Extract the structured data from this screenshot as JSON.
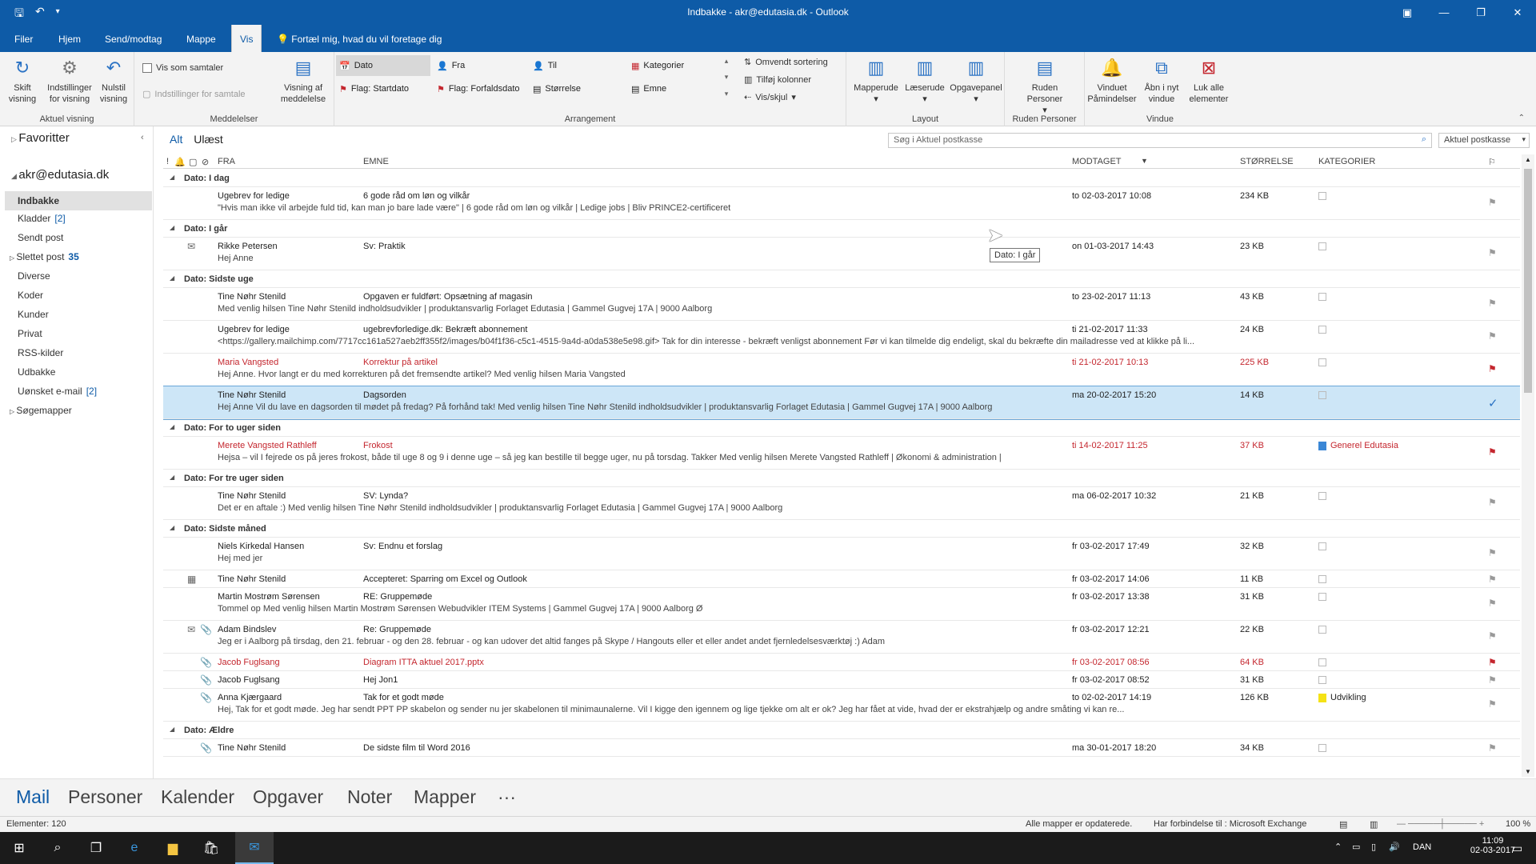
{
  "window": {
    "title": "Indbakke - akr@edutasia.dk - Outlook"
  },
  "tabs": [
    "Filer",
    "Hjem",
    "Send/modtag",
    "Mappe",
    "Vis"
  ],
  "tell_me": "Fortæl mig, hvad du vil foretage dig",
  "ribbon": {
    "current_view": {
      "label": "Aktuel visning",
      "change_view": "Skift visning",
      "view_settings": "Indstillinger for visning",
      "reset_view": "Nulstil visning"
    },
    "messages": {
      "label": "Meddelelser",
      "show_as_conversations": "Vis som samtaler",
      "conversation_settings": "Indstillinger for samtale",
      "message_preview": "Visning af meddelelse"
    },
    "arrangement": {
      "label": "Arrangement",
      "items": [
        "Dato",
        "Fra",
        "Til",
        "Kategorier",
        "Flag: Startdato",
        "Flag: Forfaldsdato",
        "Størrelse",
        "Emne"
      ],
      "reverse_sort": "Omvendt sortering",
      "add_columns": "Tilføj kolonner",
      "expand_collapse": "Vis/skjul"
    },
    "layout": {
      "label": "Layout",
      "folder_pane": "Mapperude",
      "reading_pane": "Læserude",
      "todo_bar": "Opgavepanel"
    },
    "people_pane": {
      "label": "Ruden Personer",
      "people_pane": "Ruden Personer"
    },
    "window": {
      "label": "Vindue",
      "reminders": "Vinduet Påmindelser",
      "open_new": "Åbn i nyt vindue",
      "close_all": "Luk alle elementer"
    }
  },
  "nav": {
    "favorites": "Favoritter",
    "account": "akr@edutasia.dk",
    "folders": [
      {
        "name": "Indbakke",
        "count": ""
      },
      {
        "name": "Kladder",
        "count": "[2]"
      },
      {
        "name": "Sendt post",
        "count": ""
      },
      {
        "name": "Slettet post",
        "count": "35"
      },
      {
        "name": "Diverse",
        "count": ""
      },
      {
        "name": "Koder",
        "count": ""
      },
      {
        "name": "Kunder",
        "count": ""
      },
      {
        "name": "Privat",
        "count": ""
      },
      {
        "name": "RSS-kilder",
        "count": ""
      },
      {
        "name": "Udbakke",
        "count": ""
      },
      {
        "name": "Uønsket e-mail",
        "count": "[2]"
      },
      {
        "name": "Søgemapper",
        "count": ""
      }
    ]
  },
  "filters": {
    "all": "Alt",
    "unread": "Ulæst"
  },
  "search": {
    "placeholder": "Søg i Aktuel postkasse",
    "scope": "Aktuel postkasse"
  },
  "columns": {
    "from": "FRA",
    "subject": "EMNE",
    "received": "MODTAGET",
    "size": "STØRRELSE",
    "categories": "KATEGORIER"
  },
  "groups": [
    {
      "label": "Dato: I dag",
      "messages": [
        {
          "from": "Ugebrev for ledige",
          "subject": "6 gode råd om løn og vilkår",
          "preview": "\"Hvis man ikke vil arbejde fuld tid, kan man jo bare lade være\" | 6 gode råd om løn og vilkår | Ledige jobs | Bliv PRINCE2-certificeret",
          "date": "to 02-03-2017 10:08",
          "size": "234 KB",
          "flagged": false,
          "icon": ""
        }
      ]
    },
    {
      "label": "Dato: I går",
      "messages": [
        {
          "from": "Rikke Petersen",
          "subject": "Sv: Praktik",
          "preview": "Hej Anne",
          "date": "on 01-03-2017 14:43",
          "size": "23 KB",
          "flagged": false,
          "icon": "reply"
        }
      ]
    },
    {
      "label": "Dato: Sidste uge",
      "messages": [
        {
          "from": "Tine Nøhr Stenild",
          "subject": "Opgaven er fuldført: Opsætning af magasin",
          "preview": "Med venlig hilsen  Tine Nøhr Stenild  indholdsudvikler | produktansvarlig  Forlaget Edutasia | Gammel Gugvej 17A | 9000 Aalborg",
          "date": "to 23-02-2017 11:13",
          "size": "43 KB",
          "flagged": false,
          "icon": ""
        },
        {
          "from": "Ugebrev for ledige",
          "subject": "ugebrevforledige.dk: Bekræft abonnement",
          "preview": "<https://gallery.mailchimp.com/7717cc161a527aeb2ff355f2/images/b04f1f36-c5c1-4515-9a4d-a0da538e5e98.gif>   Tak for din interesse - bekræft venligst abonnement  Før vi kan tilmelde dig endeligt, skal du bekræfte din mailadresse ved at klikke på li...",
          "date": "ti 21-02-2017 11:33",
          "size": "24 KB",
          "flagged": false,
          "icon": ""
        },
        {
          "from": "Maria Vangsted",
          "subject": "Korrektur på artikel",
          "preview": "Hej Anne.  Hvor langt er du med korrekturen på det fremsendte artikel?   Med venlig hilsen  Maria Vangsted",
          "date": "ti 21-02-2017 10:13",
          "size": "225 KB",
          "flagged": true,
          "icon": ""
        },
        {
          "from": "Tine Nøhr Stenild",
          "subject": "Dagsorden",
          "preview": "Hej Anne  Vil du lave en dagsorden til mødet på fredag?  På forhånd tak!  Med venlig hilsen  Tine Nøhr Stenild  indholdsudvikler | produktansvarlig  Forlaget Edutasia | Gammel Gugvej 17A | 9000 Aalborg",
          "date": "ma 20-02-2017 15:20",
          "size": "14 KB",
          "flagged": false,
          "done": true,
          "icon": ""
        }
      ]
    },
    {
      "label": "Dato: For to uger siden",
      "messages": [
        {
          "from": "Merete Vangsted Rathleff",
          "subject": "Frokost",
          "preview": "Hejsa – vil I fejrede os på jeres frokost, både til uge 8 og 9 i denne uge – så jeg kan bestille til begge uger, nu på torsdag.  Takker  Med venlig hilsen  Merete Vangsted Rathleff | Økonomi & administration |",
          "date": "ti 14-02-2017 11:25",
          "size": "37 KB",
          "flagged": true,
          "category": "Generel Edutasia",
          "category_color": "#3a87d6",
          "icon": ""
        }
      ]
    },
    {
      "label": "Dato: For tre uger siden",
      "messages": [
        {
          "from": "Tine Nøhr Stenild",
          "subject": "SV: Lynda?",
          "preview": "Det er en aftale :)  Med venlig hilsen  Tine Nøhr Stenild  indholdsudvikler | produktansvarlig  Forlaget Edutasia | Gammel Gugvej 17A | 9000 Aalborg",
          "date": "ma 06-02-2017 10:32",
          "size": "21 KB",
          "flagged": false,
          "icon": ""
        }
      ]
    },
    {
      "label": "Dato: Sidste måned",
      "messages": [
        {
          "from": "Niels Kirkedal Hansen",
          "subject": "Sv: Endnu et forslag",
          "preview": "Hej med jer",
          "date": "fr 03-02-2017 17:49",
          "size": "32 KB",
          "flagged": false,
          "icon": ""
        },
        {
          "from": "Tine Nøhr Stenild",
          "subject": "Accepteret: Sparring om Excel og Outlook",
          "preview": "",
          "date": "fr 03-02-2017 14:06",
          "size": "11 KB",
          "flagged": false,
          "icon": "meeting"
        },
        {
          "from": "Martin Mostrøm Sørensen",
          "subject": "RE: Gruppemøde",
          "preview": "Tommel op  Med venlig hilsen  Martin Mostrøm Sørensen  Webudvikler  ITEM Systems | Gammel Gugvej 17A | 9000 Aalborg Ø",
          "date": "fr 03-02-2017 13:38",
          "size": "31 KB",
          "flagged": false,
          "icon": ""
        },
        {
          "from": "Adam Bindslev",
          "subject": "Re: Gruppemøde",
          "preview": "Jeg er i Aalborg på tirsdag, den 21. februar - og den 28. februar - og kan udover det altid fanges på Skype / Hangouts eller et eller andet andet fjernledelsesværktøj :)  Adam",
          "date": "fr 03-02-2017 12:21",
          "size": "22 KB",
          "flagged": false,
          "icon": "reply-attach"
        },
        {
          "from": "Jacob Fuglsang",
          "subject": "Diagram ITTA aktuel 2017.pptx",
          "preview": "",
          "date": "fr 03-02-2017 08:56",
          "size": "64 KB",
          "flagged": true,
          "icon": "attach"
        },
        {
          "from": "Jacob Fuglsang",
          "subject": "Hej Jon1",
          "preview": "",
          "date": "fr 03-02-2017 08:52",
          "size": "31 KB",
          "flagged": false,
          "icon": "attach"
        },
        {
          "from": "Anna Kjærgaard",
          "subject": "Tak for et godt møde",
          "preview": "Hej,  Tak for et godt møde. Jeg har sendt PPT PP skabelon og sender nu jer skabelonen til minimaunalerne. Vil I kigge den igennem og lige tjekke om alt er ok?  Jeg har fået at vide, hvad der er ekstrahjælp og andre småting vi kan re...",
          "date": "to 02-02-2017 14:19",
          "size": "126 KB",
          "flagged": false,
          "category": "Udvikling",
          "category_color": "#f5e216",
          "icon": "attach"
        }
      ]
    },
    {
      "label": "Dato: Ældre",
      "messages": [
        {
          "from": "Tine Nøhr Stenild",
          "subject": "De sidste film til Word 2016",
          "preview": "",
          "date": "ma 30-01-2017 18:20",
          "size": "34 KB",
          "flagged": false,
          "icon": "attach"
        }
      ]
    }
  ],
  "tooltip": "Dato: I går",
  "modules": [
    "Mail",
    "Personer",
    "Kalender",
    "Opgaver",
    "Noter",
    "Mapper",
    "···"
  ],
  "status": {
    "items": "Elementer: 120",
    "updated": "Alle mapper er opdaterede.",
    "connection": "Har forbindelse til : Microsoft Exchange",
    "zoom": "100 %"
  },
  "taskbar": {
    "lang": "DAN",
    "time": "11:09",
    "date": "02-03-2017"
  }
}
